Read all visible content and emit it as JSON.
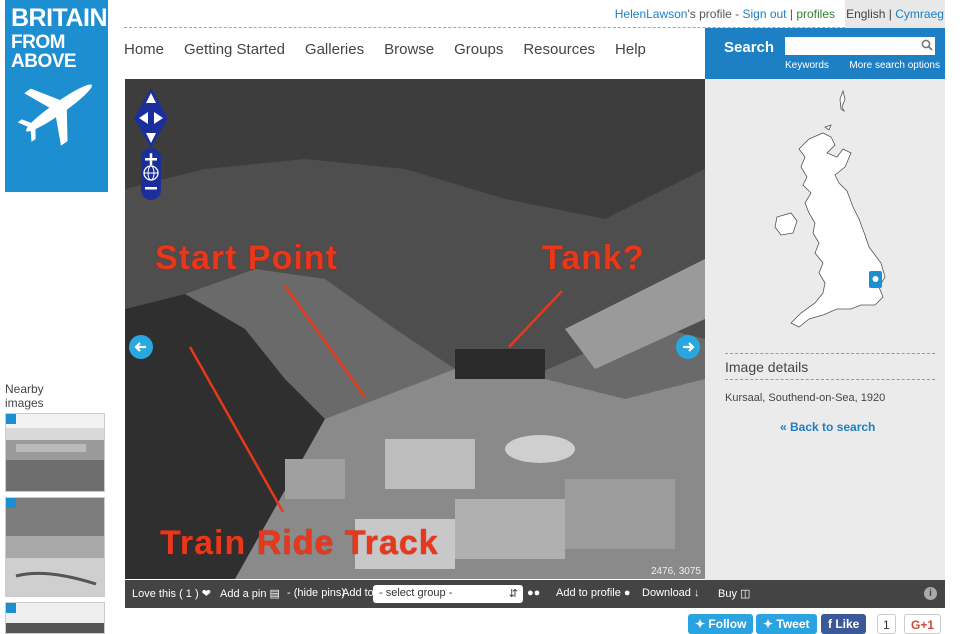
{
  "logo": {
    "line1": "BRITAIN",
    "line2": "FROM ABOVE",
    "plane_icon": "airplane-icon"
  },
  "topbar": {
    "user_name": "HelenLawson",
    "profile_suffix": "'s profile",
    "separator1": " - ",
    "sign_out": "Sign out",
    "separator2": " | ",
    "profiles": "profiles",
    "lang_english": "English",
    "lang_sep": " | ",
    "lang_cymraeg": "Cymraeg"
  },
  "nav": [
    "Home",
    "Getting Started",
    "Galleries",
    "Browse",
    "Groups",
    "Resources",
    "Help"
  ],
  "search": {
    "label": "Search",
    "placeholder": "",
    "keywords": "Keywords",
    "more_options": "More search options"
  },
  "details": {
    "heading": "Image details",
    "caption": "Kursaal, Southend-on-Sea, 1920",
    "back": "« Back to search"
  },
  "nearby": {
    "label": "Nearby images"
  },
  "photo": {
    "annotations": {
      "start": "Start Point",
      "tank": "Tank?",
      "track": "Train Ride Track"
    },
    "coords": "2476, 3075"
  },
  "toolbar": {
    "love": "Love this ( 1 )",
    "add_pin": "Add a pin",
    "hide_pins": "- (hide pins)",
    "add_to": "Add to",
    "group_select": "- select group -",
    "add_profile": "Add to profile",
    "download": "Download",
    "buy": "Buy"
  },
  "social": {
    "follow": "Follow",
    "tweet": "Tweet",
    "like": "Like",
    "like_count": "1",
    "gplus": "G+1"
  },
  "colors": {
    "brand_blue": "#1d8fd1",
    "annotation_red": "#e8381c",
    "toolbar": "#444444"
  }
}
